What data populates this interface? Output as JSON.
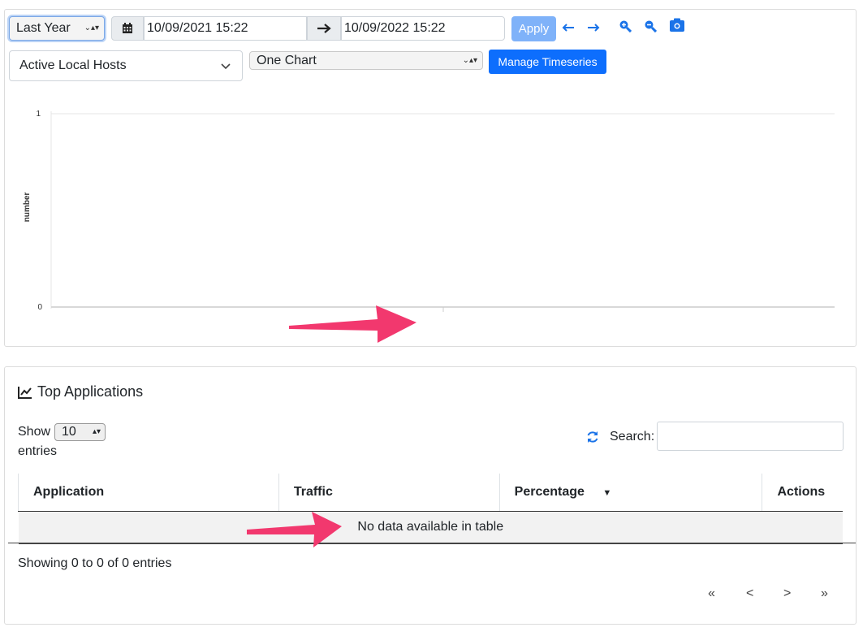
{
  "toolbar": {
    "range": "Last Year",
    "date_from": "10/09/2021 15:22",
    "date_to": "10/09/2022 15:22",
    "apply": "Apply"
  },
  "metric": "Active Local Hosts",
  "layout": "One Chart",
  "manage": "Manage Timeseries",
  "chart_data": {
    "type": "line",
    "title": "",
    "ylabel": "number",
    "xlabel": "",
    "y_ticks": [
      "1",
      "0"
    ],
    "ylim": [
      0,
      1
    ],
    "series": []
  },
  "apps": {
    "title": "Top Applications",
    "show": "Show",
    "entries": "entries",
    "page_length": "10",
    "search_label": "Search:",
    "columns": [
      "Application",
      "Traffic",
      "Percentage",
      "Actions"
    ],
    "sort_indicator": "▼",
    "empty": "No data available in table",
    "info": "Showing 0 to 0 of 0 entries",
    "pager": [
      "«",
      "<",
      ">",
      "»"
    ]
  },
  "colors": {
    "accent": "#0d6efd",
    "annotation_arrow": "#f2386e"
  }
}
